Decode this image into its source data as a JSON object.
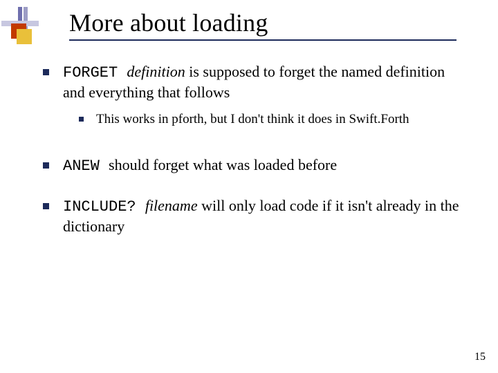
{
  "title": "More about loading",
  "bullets": [
    {
      "code": "FORGET ",
      "ital": "definition",
      "rest": "  is supposed to forget the named definition and everything that follows",
      "sub": [
        {
          "text": "This works in pforth, but I don't think it does in Swift.Forth"
        }
      ]
    },
    {
      "code": "ANEW ",
      "ital": "",
      "rest": "should forget what was loaded before",
      "sub": []
    },
    {
      "code": "INCLUDE? ",
      "ital": "filename",
      "rest": " will only load code if it isn't already in the dictionary",
      "sub": []
    }
  ],
  "page_number": "15"
}
